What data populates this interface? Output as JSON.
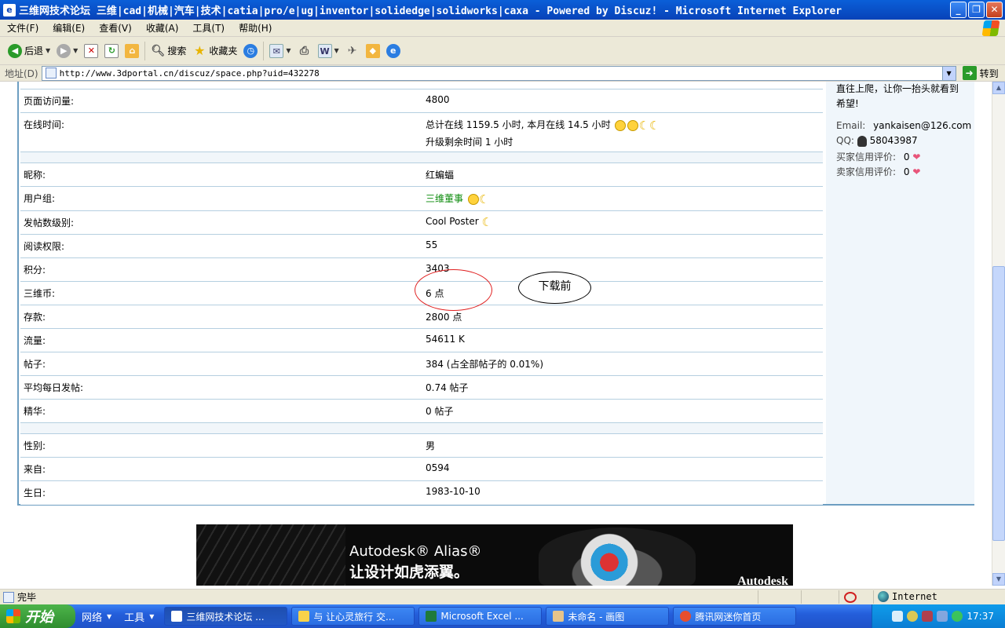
{
  "window": {
    "title": "三维网技术论坛 三维|cad|机械|汽车|技术|catia|pro/e|ug|inventor|solidedge|solidworks|caxa - Powered by Discuz! - Microsoft Internet Explorer"
  },
  "menu": [
    "文件(F)",
    "编辑(E)",
    "查看(V)",
    "收藏(A)",
    "工具(T)",
    "帮助(H)"
  ],
  "toolbar": {
    "back_label": "后退",
    "search_label": "搜索",
    "favorites_label": "收藏夹"
  },
  "address": {
    "label": "地址(D)",
    "url": "http://www.3dportal.cn/discuz/space.php?uid=432278",
    "go_label": "转到"
  },
  "profile": {
    "page_views": {
      "label": "页面访问量:",
      "value": "4800"
    },
    "online_time": {
      "label": "在线时间:",
      "line1": "总计在线 1159.5 小时, 本月在线 14.5 小时",
      "line2": "升级剩余时间 1 小时"
    },
    "nickname": {
      "label": "昵称:",
      "value": "红蝙蝠"
    },
    "user_group": {
      "label": "用户组:",
      "value": "三维董事"
    },
    "post_rank": {
      "label": "发帖数级别:",
      "value": "Cool Poster"
    },
    "read_access": {
      "label": "阅读权限:",
      "value": "55"
    },
    "credits": {
      "label": "积分:",
      "value": "3403"
    },
    "coins": {
      "label": "三维币:",
      "value": "6 点"
    },
    "deposit": {
      "label": "存款:",
      "value": "2800 点"
    },
    "traffic": {
      "label": "流量:",
      "value": "54611 K"
    },
    "posts": {
      "label": "帖子:",
      "value": "384 (占全部帖子的 0.01%)"
    },
    "avg_posts": {
      "label": "平均每日发帖:",
      "value": "0.74 帖子"
    },
    "digest": {
      "label": "精华:",
      "value": "0 帖子"
    },
    "gender": {
      "label": "性别:",
      "value": "男"
    },
    "location": {
      "label": "来自:",
      "value": "0594"
    },
    "birthday": {
      "label": "生日:",
      "value": "1983-10-10"
    }
  },
  "sidebar": {
    "motto_line1": "直往上爬，让你一抬头就看到",
    "motto_line2": "希望!",
    "email_label": "Email:",
    "email": "yankaisen@126.com",
    "qq_label": "QQ:",
    "qq": "58043987",
    "buyer_label": "买家信用评价:",
    "buyer_value": "0",
    "seller_label": "卖家信用评价:",
    "seller_value": "0"
  },
  "annotation": {
    "note": "下载前"
  },
  "banner": {
    "brand": "Autodesk® Alias®",
    "tagline": "让设计如虎添翼。",
    "logo_text": "Autodesk"
  },
  "status": {
    "text": "完毕",
    "zone": "Internet"
  },
  "taskbar": {
    "start": "开始",
    "quick": [
      "网络",
      "工具"
    ],
    "tasks": [
      "三维网技术论坛 ...",
      "与 让心灵旅行 交...",
      "Microsoft Excel ...",
      "未命名 - 画图",
      "腾讯网迷你首页"
    ],
    "clock": "17:37"
  },
  "colors": {
    "panel_border": "#6d9ec1",
    "row_divider": "#b5cfe0",
    "annotation_red": "#e02020",
    "group_green": "#0a8a0a"
  }
}
